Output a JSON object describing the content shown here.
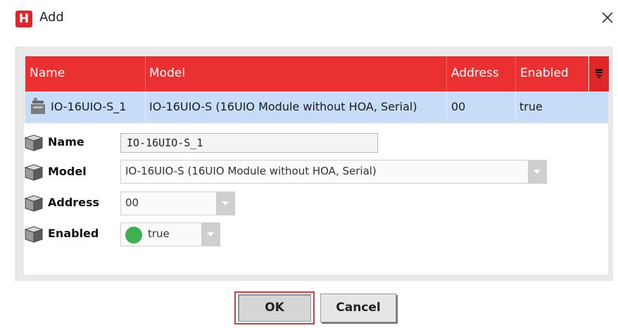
{
  "window": {
    "title": "Add",
    "app_icon_letter": "H",
    "close_glyph": "×"
  },
  "table": {
    "columns": [
      "Name",
      "Model",
      "Address",
      "Enabled"
    ],
    "rows": [
      {
        "name": "IO-16UIO-S_1",
        "model": "IO-16UIO-S (16UIO Module without HOA, Serial)",
        "address": "00",
        "enabled": "true"
      }
    ]
  },
  "form": {
    "name_label": "Name",
    "name_value": "IO-16UIO-S_1",
    "model_label": "Model",
    "model_value": "IO-16UIO-S (16UIO Module without HOA, Serial)",
    "address_label": "Address",
    "address_value": "00",
    "enabled_label": "Enabled",
    "enabled_value": "true"
  },
  "buttons": {
    "ok": "OK",
    "cancel": "Cancel"
  },
  "colors": {
    "header": "#ea3030",
    "selected_row": "#c7dcf7",
    "toggle_on": "#3eb052",
    "ok_highlight": "#e03b3b"
  },
  "icons": [
    "app-icon",
    "close-icon",
    "column-menu-icon",
    "device-icon",
    "property-icon",
    "dropdown-arrow-icon"
  ]
}
